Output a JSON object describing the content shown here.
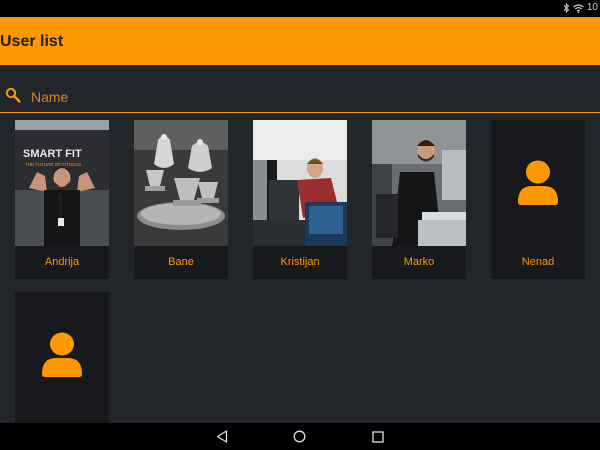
{
  "status_bar": {
    "clock": "10"
  },
  "app_bar": {
    "title": "User list"
  },
  "search": {
    "placeholder": "Name",
    "value": ""
  },
  "users": [
    {
      "name": "Andrija",
      "photo": "gym-photo",
      "logo_text": "SMART FIT",
      "tagline": "THE FUTURE OF FITNESS"
    },
    {
      "name": "Bane",
      "photo": "teapots-photo"
    },
    {
      "name": "Kristijan",
      "photo": "office-desk-photo"
    },
    {
      "name": "Marko",
      "photo": "office-desk-photo"
    },
    {
      "name": "Nenad",
      "photo": "default-avatar-icon"
    },
    {
      "name": "",
      "photo": "default-avatar-icon"
    }
  ],
  "nav": {
    "buttons": [
      "back-icon",
      "home-icon",
      "recents-icon"
    ]
  },
  "colors": {
    "accent": "#ff9800",
    "background": "#22252a",
    "card": "#17191c"
  }
}
